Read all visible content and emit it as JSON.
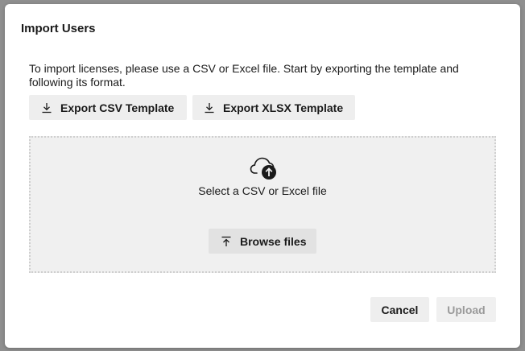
{
  "dialog": {
    "title": "Import Users",
    "instructions": "To import licenses, please use a CSV or Excel file. Start by exporting the template and following its format."
  },
  "export_buttons": {
    "csv_label": "Export CSV Template",
    "xlsx_label": "Export XLSX Template",
    "icon": "download-icon"
  },
  "dropzone": {
    "icon": "cloud-upload-icon",
    "label": "Select a CSV or Excel file",
    "browse_label": "Browse files",
    "browse_icon": "upload-arrow-icon"
  },
  "footer": {
    "cancel_label": "Cancel",
    "upload_label": "Upload"
  },
  "colors": {
    "button_bg": "#eeeeee",
    "dropzone_bg": "#f0f0f0",
    "disabled_text": "#9a9a9a"
  }
}
